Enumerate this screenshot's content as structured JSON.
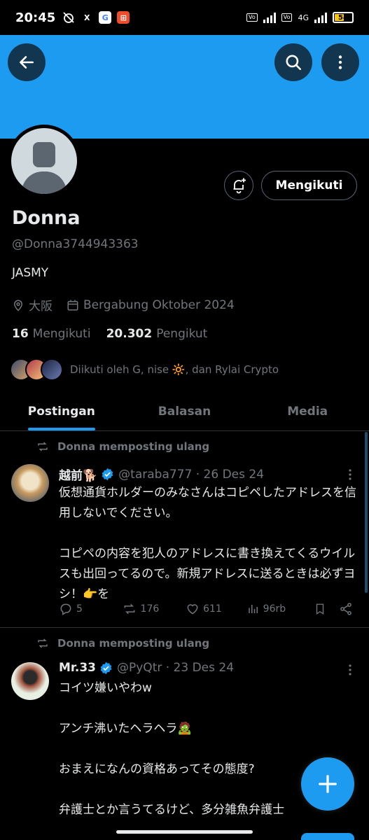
{
  "status_bar": {
    "time": "20:45",
    "network": "4G",
    "battery": "54",
    "battery_level": 0.54,
    "app_icons": [
      "X",
      "G"
    ]
  },
  "profile": {
    "name": "Donna",
    "handle": "@Donna3744943363",
    "bio": "JASMY",
    "location": "大阪",
    "joined": "Bergabung Oktober 2024",
    "following_count": "16",
    "following_label": "Mengikuti",
    "followers_count": "20.302",
    "followers_label": "Pengikut",
    "followed_by": "Diikuti oleh G, nise 🔆, dan Rylai Crypto",
    "follow_button": "Mengikuti"
  },
  "tabs": [
    "Postingan",
    "Balasan",
    "Media"
  ],
  "posts": [
    {
      "repost_label": "Donna memposting ulang",
      "name": "越前🐕",
      "handle": "@taraba777 · 26 Des 24",
      "text": "仮想通貨ホルダーのみなさんはコピペしたアドレスを信用しないでください。\n\nコピペの内容を犯人のアドレスに書き換えてくるウイルスも出回ってるので。新規アドレスに送るときは必ずヨシ！👉を",
      "replies": "5",
      "reposts": "176",
      "likes": "611",
      "views": "96rb"
    },
    {
      "repost_label": "Donna memposting ulang",
      "name": "Mr.33",
      "handle": "@PyQtr · 23 Des 24",
      "text": "コイツ嫌いやわw\n\nアンチ沸いたヘラヘラ🧟\n\nおまえになんの資格あってその態度?\n\n弁護士とか言うてるけど、多分雑魚弁護士"
    }
  ],
  "colors": {
    "accent": "#1d9bf0",
    "background": "#000000",
    "text": "#e7e9ea",
    "muted": "#71767b"
  },
  "icons": [
    "back-arrow-icon",
    "search-icon",
    "more-vertical-icon",
    "bell-plus-icon",
    "location-pin-icon",
    "calendar-icon",
    "repost-icon",
    "verified-badge-icon",
    "reply-icon",
    "like-icon",
    "views-icon",
    "bookmark-icon",
    "share-icon",
    "plus-icon"
  ]
}
